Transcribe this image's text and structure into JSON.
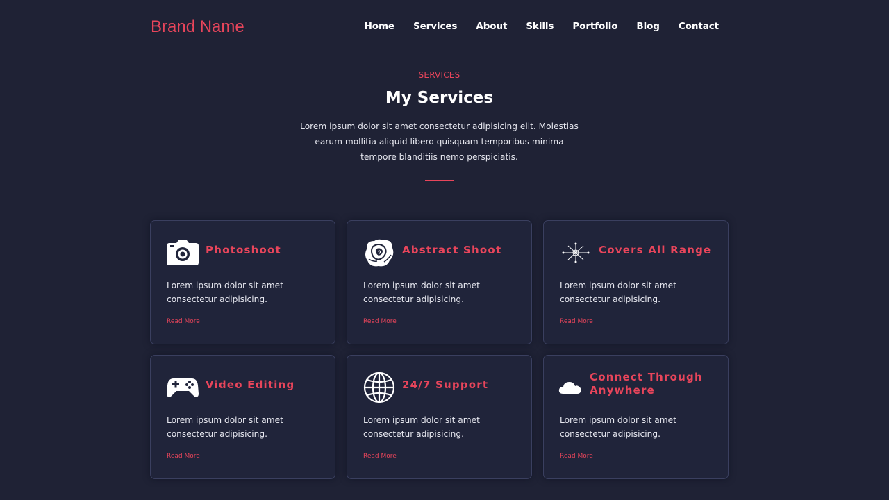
{
  "header": {
    "brand": "Brand Name",
    "nav": [
      "Home",
      "Services",
      "About",
      "Skills",
      "Portfolio",
      "Blog",
      "Contact"
    ]
  },
  "section": {
    "tag": "SERVICES",
    "title": "My Services",
    "description": "Lorem ipsum dolor sit amet consectetur adipisicing elit. Molestias earum mollitia aliquid libero quisquam temporibus minima tempore blanditiis nemo perspiciatis."
  },
  "cards": [
    {
      "icon": "camera-icon",
      "title": "Photoshoot",
      "text": "Lorem ipsum dolor sit amet consectetur adipisicing.",
      "link": "Read More"
    },
    {
      "icon": "rose-icon",
      "title": "Abstract Shoot",
      "text": "Lorem ipsum dolor sit amet consectetur adipisicing.",
      "link": "Read More"
    },
    {
      "icon": "range-360-icon",
      "title": "Covers All Range",
      "text": "Lorem ipsum dolor sit amet consectetur adipisicing.",
      "link": "Read More"
    },
    {
      "icon": "gamepad-icon",
      "title": "Video Editing",
      "text": "Lorem ipsum dolor sit amet consectetur adipisicing.",
      "link": "Read More"
    },
    {
      "icon": "globe-icon",
      "title": "24/7 Support",
      "text": "Lorem ipsum dolor sit amet consectetur adipisicing.",
      "link": "Read More"
    },
    {
      "icon": "cloud-icon",
      "title": "Connect Through Anywhere",
      "text": "Lorem ipsum dolor sit amet consectetur adipisicing.",
      "link": "Read More"
    }
  ],
  "colors": {
    "background": "#1f2235",
    "accent": "#e8455b",
    "card_border": "#3a3f5f",
    "text": "#e6e7ef"
  }
}
